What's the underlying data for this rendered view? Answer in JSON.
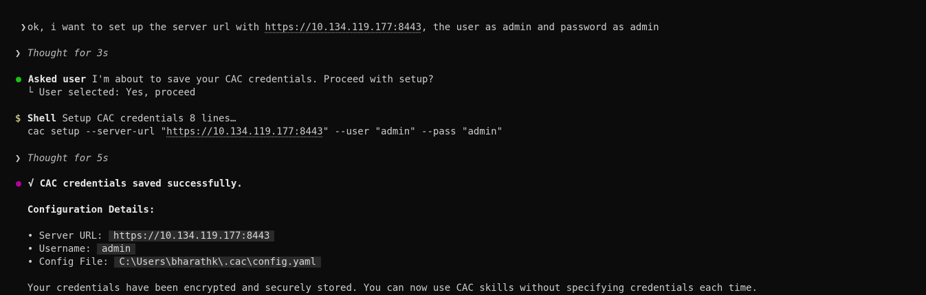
{
  "user_prompt": {
    "arrow": "❯",
    "text_before": "ok, i want to set up the server url with ",
    "url": "https://10.134.119.177:8443",
    "text_after": ", the user as admin and password as admin"
  },
  "thought1": {
    "arrow": "❯",
    "text": "Thought for 3s"
  },
  "asked": {
    "label": "Asked user",
    "question": " I'm about to save your CAC credentials. Proceed with setup?",
    "branch": "└",
    "selection": " User selected: Yes, proceed"
  },
  "shell": {
    "symbol": "$",
    "label": "Shell",
    "description": " Setup CAC credentials 8 lines…",
    "cmd_before": "cac setup --server-url \"",
    "cmd_url": "https://10.134.119.177:8443",
    "cmd_after": "\" --user \"admin\" --pass \"admin\""
  },
  "thought2": {
    "arrow": "❯",
    "text": "Thought for 5s"
  },
  "result": {
    "success": "√ CAC credentials saved successfully.",
    "details_heading": "Configuration Details:",
    "items": [
      {
        "bullet": "•",
        "label": "Server URL:",
        "value": "https://10.134.119.177:8443"
      },
      {
        "bullet": "•",
        "label": "Username:",
        "value": "admin"
      },
      {
        "bullet": "•",
        "label": "Config File:",
        "value": "C:\\Users\\bharathk\\.cac\\config.yaml"
      }
    ],
    "footer": "Your credentials have been encrypted and securely stored. You can now use CAC skills without specifying credentials each time."
  },
  "colors": {
    "background": "#0c0c0c",
    "text": "#cccccc",
    "green_bullet": "#16c60c",
    "magenta_bullet": "#b4009e",
    "dollar": "#f9f1a5",
    "code_bg": "#2a2a2a"
  }
}
